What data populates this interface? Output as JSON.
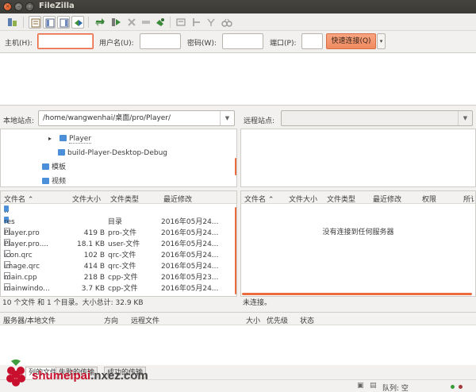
{
  "window": {
    "title": "FileZilla"
  },
  "toolbar": {
    "icons": [
      "site-manager-icon",
      "toggle-log-icon",
      "toggle-tree-icon",
      "toggle-queue-icon",
      "refresh-icon",
      "process-queue-icon",
      "cancel-icon",
      "disconnect-icon",
      "reconnect-icon",
      "filter-icon",
      "compare-icon",
      "sync-browse-icon",
      "search-icon"
    ]
  },
  "quickconnect": {
    "host_label": "主机(H):",
    "user_label": "用户名(U):",
    "pass_label": "密码(W):",
    "port_label": "端口(P):",
    "host_value": "",
    "user_value": "",
    "pass_value": "",
    "port_value": "",
    "connect_label": "快速连接(Q)",
    "dropdown": "▾"
  },
  "local": {
    "site_label": "本地站点:",
    "path": "/home/wangwenhai/桌面/pro/Player/",
    "tree": [
      {
        "label": "Player",
        "expander": "▸"
      },
      {
        "label": "build-Player-Desktop-Debug"
      },
      {
        "label": "模板"
      },
      {
        "label": "视频"
      }
    ],
    "columns": [
      "文件名 ⌃",
      "文件大小",
      "文件类型",
      "最近修改"
    ],
    "files": [
      {
        "name": "..",
        "size": "",
        "type": "",
        "modified": ""
      },
      {
        "name": "res",
        "size": "",
        "type": "目录",
        "modified": "2016年05月24..."
      },
      {
        "name": "Player.pro",
        "size": "419 B",
        "type": "pro-文件",
        "modified": "2016年05月24..."
      },
      {
        "name": "Player.pro....",
        "size": "18.1 KB",
        "type": "user-文件",
        "modified": "2016年05月24..."
      },
      {
        "name": "icon.qrc",
        "size": "102 B",
        "type": "qrc-文件",
        "modified": "2016年05月24..."
      },
      {
        "name": "image.qrc",
        "size": "414 B",
        "type": "qrc-文件",
        "modified": "2016年05月24..."
      },
      {
        "name": "main.cpp",
        "size": "218 B",
        "type": "cpp-文件",
        "modified": "2016年05月23..."
      },
      {
        "name": "mainwindo...",
        "size": "3.7 KB",
        "type": "cpp-文件",
        "modified": "2016年05月24..."
      }
    ],
    "status": "10 个文件 和 1 个目录。大小总计: 32.9 KB"
  },
  "remote": {
    "site_label": "远程站点:",
    "path": "",
    "columns": [
      "文件名 ⌃",
      "文件大小",
      "文件类型",
      "最近修改",
      "权限",
      "所讠"
    ],
    "empty_message": "没有连接到任何服务器",
    "status": "未连接。"
  },
  "queue": {
    "columns": [
      "服务器/本地文件",
      "方向",
      "远程文件",
      "大小",
      "优先级",
      "状态"
    ],
    "tabs": [
      "列的文件",
      "失败的传输",
      "成功的传输"
    ],
    "status": "队列: 空"
  },
  "watermark": {
    "text_main": "shumeipai",
    "text_dom": ".nxez.com"
  },
  "colors": {
    "accent": "#e96b3e",
    "folder": "#4a8fd8"
  }
}
